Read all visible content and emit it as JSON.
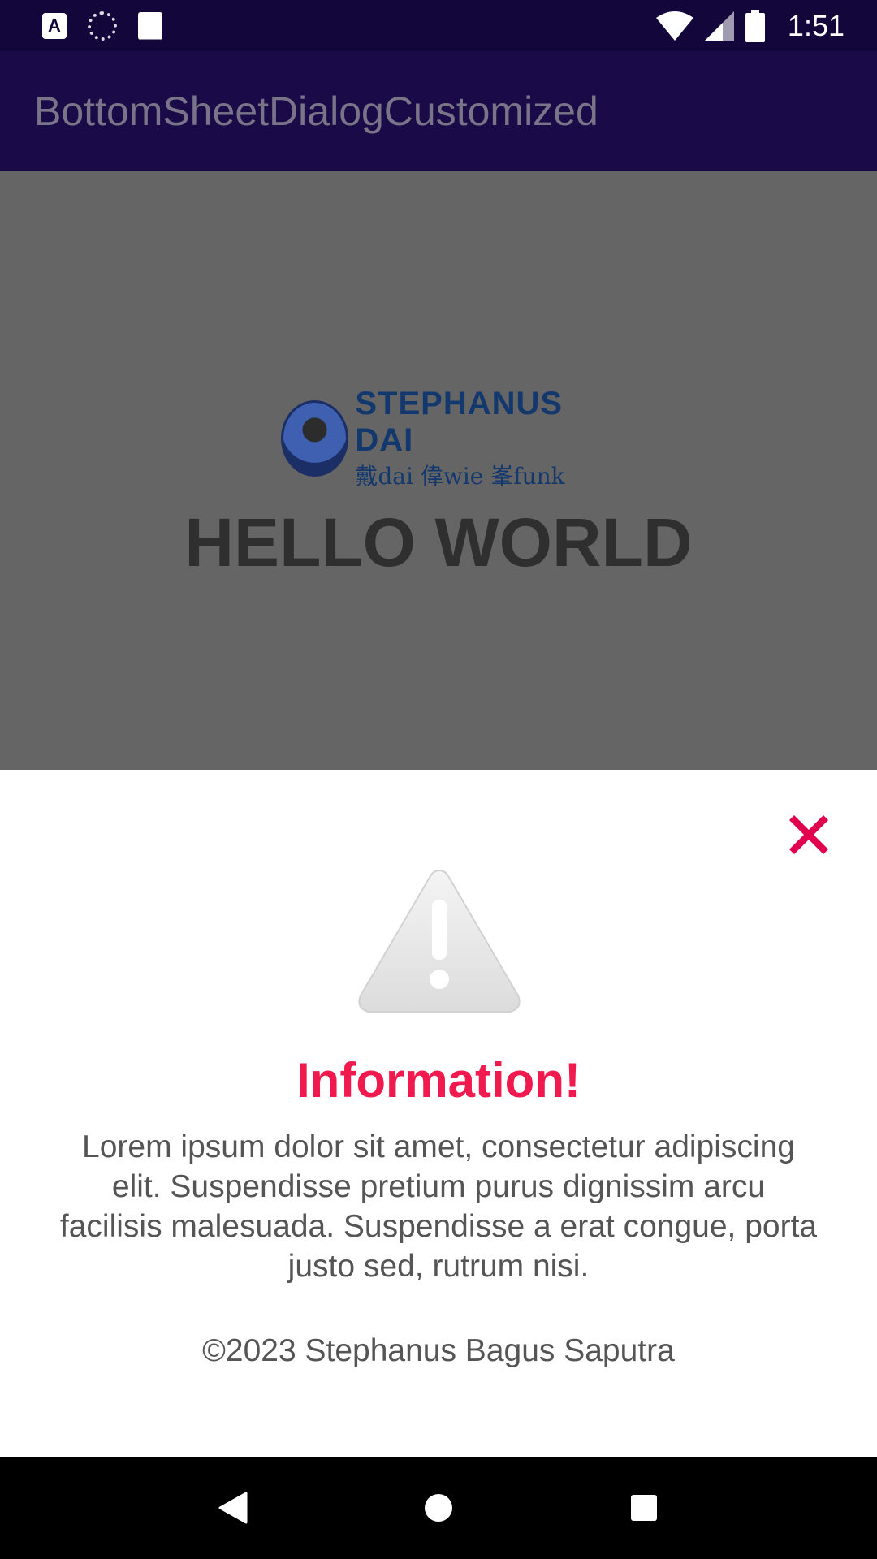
{
  "status_bar": {
    "time": "1:51",
    "notification_letter": "A",
    "icons": [
      "accessibility-icon",
      "loader-icon",
      "sd-card-icon",
      "wifi-icon",
      "signal-icon",
      "battery-icon"
    ]
  },
  "app_bar": {
    "title": "BottomSheetDialogCustomized"
  },
  "content": {
    "logo_name": "STEPHANUS DAI",
    "logo_sub": "戴dai 偉wie 峯funk",
    "heading": "HELLO WORLD"
  },
  "bottom_sheet": {
    "title": "Information!",
    "message": "Lorem ipsum dolor sit amet, consectetur adipiscing elit. Suspendisse pretium purus dignissim arcu facilisis malesuada. Suspendisse a erat congue, porta justo sed, rutrum nisi.",
    "copyright": "©2023 Stephanus Bagus Saputra",
    "accent_color": "#f01a4f",
    "close_color": "#e0004e"
  },
  "colors": {
    "status_bar": "#13063a",
    "app_bar": "#1b0a48",
    "scrim": "#656565",
    "sheet": "#ffffff"
  }
}
